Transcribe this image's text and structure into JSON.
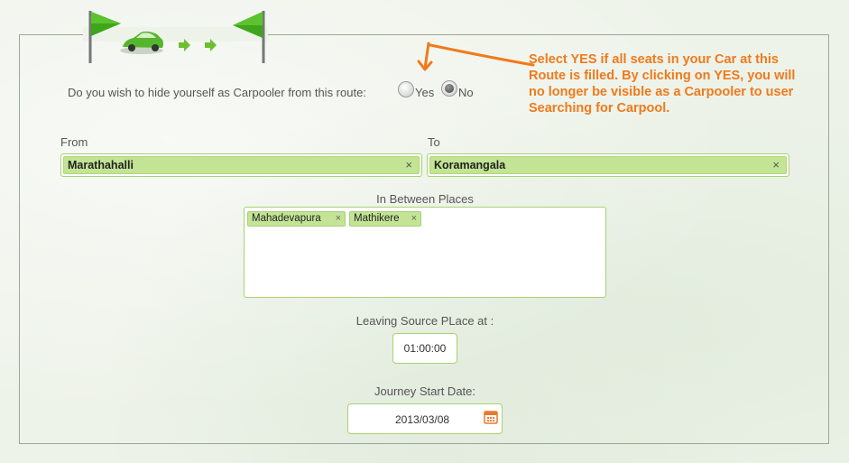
{
  "hide_question": {
    "text": "Do you wish to hide yourself as Carpooler from this route:",
    "options": [
      {
        "label": "Yes",
        "checked": false
      },
      {
        "label": "No",
        "checked": true
      }
    ]
  },
  "annotation": {
    "lines": [
      "Select YES if all seats in your Car at this",
      "Route is filled. By clicking on YES, you will",
      "no longer be visible as a Carpooler to user",
      "Searching for Carpool."
    ],
    "color": "#f07a1c"
  },
  "from": {
    "label": "From",
    "value": "Marathahalli",
    "remove": "×"
  },
  "to": {
    "label": "To",
    "value": "Koramangala",
    "remove": "×"
  },
  "between": {
    "label": "In Between Places",
    "chips": [
      {
        "text": "Mahadevapura",
        "remove": "×"
      },
      {
        "text": "Mathikere",
        "remove": "×"
      }
    ]
  },
  "leaving": {
    "label": "Leaving Source PLace at :",
    "value": "01:00:00"
  },
  "journey": {
    "label": "Journey Start Date:",
    "value": "2013/03/08"
  },
  "icons": {
    "start_flag": "start-flag-icon",
    "car": "car-icon",
    "arrow1": "arrow-right-icon",
    "arrow2": "arrow-right-icon",
    "end_flag": "end-flag-icon",
    "calendar": "calendar-icon"
  },
  "colors": {
    "field_border": "#a8d36f",
    "token_fill": "#c3e495",
    "flag_green": "#3fa51a"
  }
}
